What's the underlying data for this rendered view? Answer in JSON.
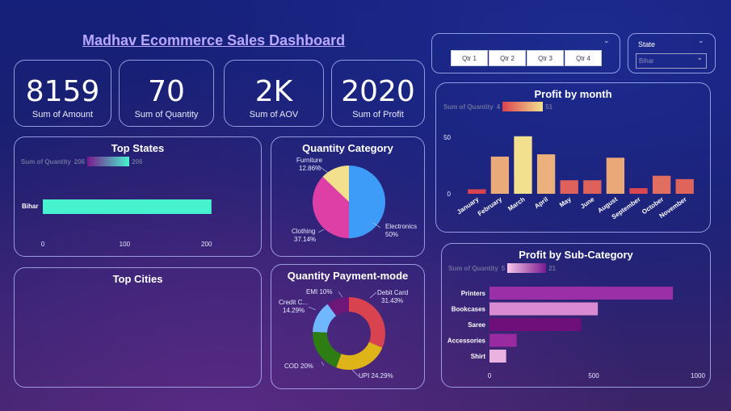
{
  "dashboard": {
    "title": "Madhav Ecommerce Sales Dashboard"
  },
  "kpis": [
    {
      "value": "8159",
      "label": "Sum of Amount"
    },
    {
      "value": "70",
      "label": "Sum of Quantity"
    },
    {
      "value": "2K",
      "label": "Sum of AOV"
    },
    {
      "value": "2020",
      "label": "Sum of Profit"
    }
  ],
  "quarter_slicer": {
    "options": [
      "Qtr 1",
      "Qtr 2",
      "Qtr 3",
      "Qtr 4"
    ]
  },
  "state_slicer": {
    "label": "State",
    "selected": "Bihar"
  },
  "top_states": {
    "title": "Top States",
    "legend": {
      "label": "Sum of Quantity",
      "min": "206",
      "max": "206"
    },
    "categories": [
      "Bihar"
    ],
    "values": [
      206
    ],
    "ticks": [
      "0",
      "100",
      "200"
    ],
    "xlim": [
      0,
      220
    ],
    "color": "#47f2cf"
  },
  "top_cities": {
    "title": "Top Cities"
  },
  "quantity_category": {
    "title": "Quantity Category",
    "slices": [
      {
        "label": "Electronics",
        "pct": "50%",
        "value": 50,
        "color": "#3d9cf7"
      },
      {
        "label": "Clothing",
        "pct": "37.14%",
        "value": 37.14,
        "color": "#de3fa7"
      },
      {
        "label": "Furniture",
        "pct": "12.86%",
        "value": 12.86,
        "color": "#f2e08f"
      }
    ]
  },
  "payment_mode": {
    "title": "Quantity Payment-mode",
    "slices": [
      {
        "label": "Debit Card",
        "pct": "31.43%",
        "value": 31.43,
        "color": "#d9434f"
      },
      {
        "label": "UPI",
        "pct": "24.29%",
        "value": 24.29,
        "color": "#dfb419"
      },
      {
        "label": "COD",
        "pct": "20%",
        "value": 20,
        "color": "#2e7d12"
      },
      {
        "label": "Credit C...",
        "pct": "14.29%",
        "value": 14.29,
        "color": "#6fb7ff"
      },
      {
        "label": "EMI",
        "pct": "10%",
        "value": 10,
        "color": "#6f1679"
      }
    ]
  },
  "profit_by_month": {
    "title": "Profit by month",
    "legend": {
      "label": "Sum of Quantity",
      "min": "4",
      "max": "51"
    },
    "categories": [
      "January",
      "February",
      "March",
      "April",
      "May",
      "June",
      "August",
      "September",
      "October",
      "November"
    ],
    "values": [
      4,
      33,
      51,
      35,
      12,
      12,
      32,
      5,
      16,
      13
    ],
    "ticks": [
      "0",
      "50"
    ],
    "ylim": [
      0,
      58
    ]
  },
  "profit_by_subcategory": {
    "title": "Profit by Sub-Category",
    "legend": {
      "label": "Sum of Quantity",
      "min": "5",
      "max": "21"
    },
    "categories": [
      "Printers",
      "Bookcases",
      "Saree",
      "Accessories",
      "Shirt"
    ],
    "values": [
      880,
      520,
      440,
      130,
      80
    ],
    "colors": [
      "#9b2fa8",
      "#d98ad0",
      "#6f0f7a",
      "#9a2aa0",
      "#eab3df"
    ],
    "ticks": [
      "0",
      "500",
      "1000"
    ],
    "xlim": [
      0,
      1000
    ]
  }
}
